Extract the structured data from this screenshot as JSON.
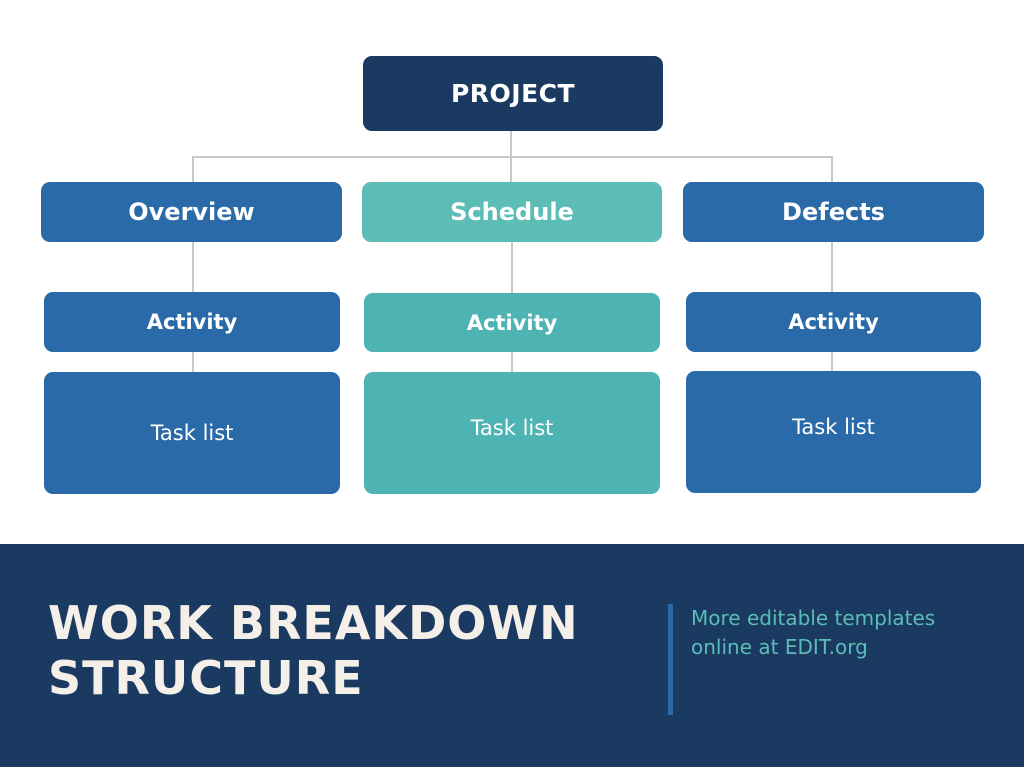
{
  "colors": {
    "root": "#1b3a62",
    "blue_branch": "#2a6aa9",
    "teal_branch": "#5bbdb6",
    "teal_child": "#4db3b3",
    "connector": "#c8c8c8",
    "banner": "#1b3a62",
    "banner_title": "#f4efe8",
    "banner_note": "#5bbdb6"
  },
  "diagram": {
    "root": {
      "label": "PROJECT"
    },
    "branches": [
      {
        "label": "Overview",
        "color_theme": "blue",
        "activity": "Activity",
        "tasks": "Task list"
      },
      {
        "label": "Schedule",
        "color_theme": "teal",
        "activity": "Activity",
        "tasks": "Task list"
      },
      {
        "label": "Defects",
        "color_theme": "blue",
        "activity": "Activity",
        "tasks": "Task list"
      }
    ]
  },
  "banner": {
    "title_line1": "WORK BREAKDOWN",
    "title_line2": "STRUCTURE",
    "note_line1": "More editable templates",
    "note_line2": "online at EDIT.org"
  }
}
